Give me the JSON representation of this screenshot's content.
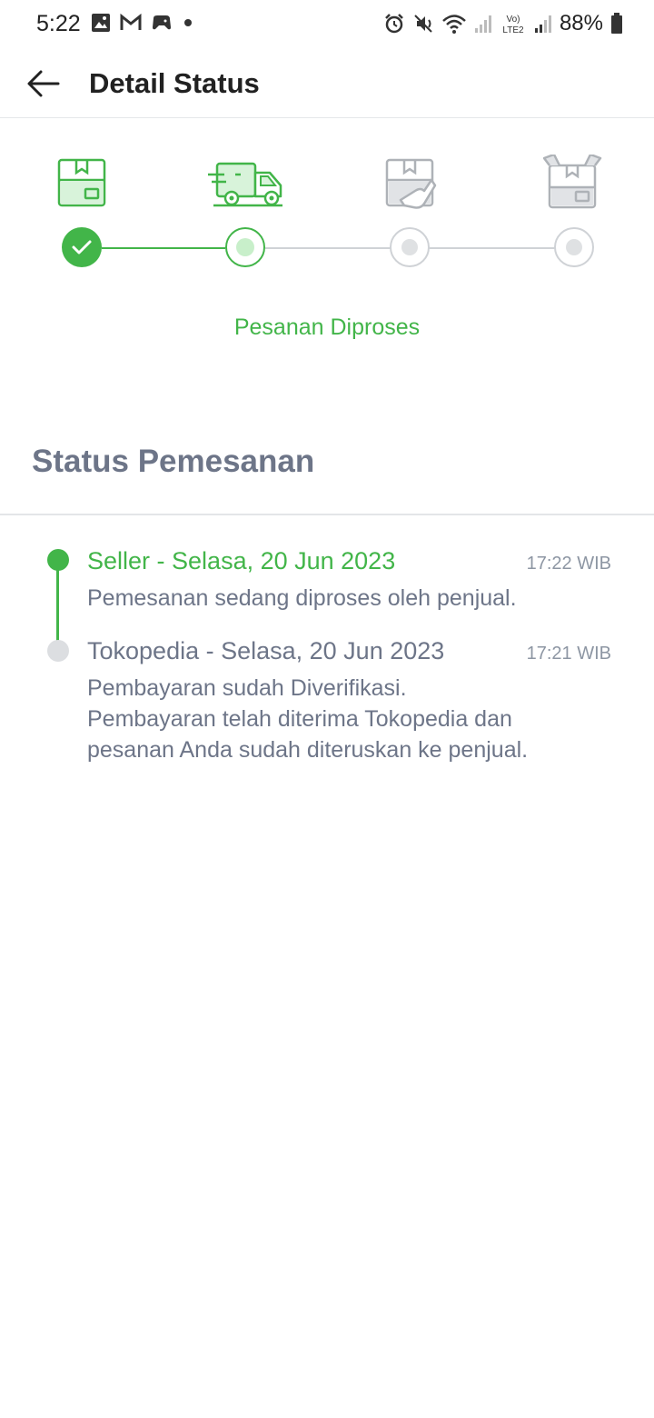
{
  "status_bar": {
    "time": "5:22",
    "battery": "88%",
    "left_icons": [
      "gallery-icon",
      "gmail-icon",
      "game-icon",
      "dot-icon"
    ],
    "right_icons": [
      "alarm-icon",
      "mute-icon",
      "wifi-icon",
      "signal-icon",
      "volte-icon",
      "signal-icon",
      "battery-icon"
    ]
  },
  "header": {
    "title": "Detail Status"
  },
  "stepper": {
    "current_status": "Pesanan Diproses",
    "steps": [
      {
        "icon": "package-icon",
        "state": "done"
      },
      {
        "icon": "delivery-truck-icon",
        "state": "active"
      },
      {
        "icon": "package-handover-icon",
        "state": "todo"
      },
      {
        "icon": "open-package-icon",
        "state": "todo"
      }
    ],
    "colors": {
      "done": "#42b549",
      "todo": "#cfd2d6"
    }
  },
  "order_status": {
    "title": "Status Pemesanan",
    "events": [
      {
        "heading": "Seller - Selasa, 20 Jun 2023",
        "time": "17:22 WIB",
        "lines": [
          "Pemesanan sedang diproses oleh penjual."
        ],
        "color": "#42b549"
      },
      {
        "heading": "Tokopedia - Selasa, 20 Jun 2023",
        "time": "17:21 WIB",
        "lines": [
          "Pembayaran sudah Diverifikasi.",
          "Pembayaran telah diterima Tokopedia dan",
          "pesanan Anda sudah diteruskan ke penjual."
        ],
        "color": "#6d7588"
      }
    ]
  }
}
